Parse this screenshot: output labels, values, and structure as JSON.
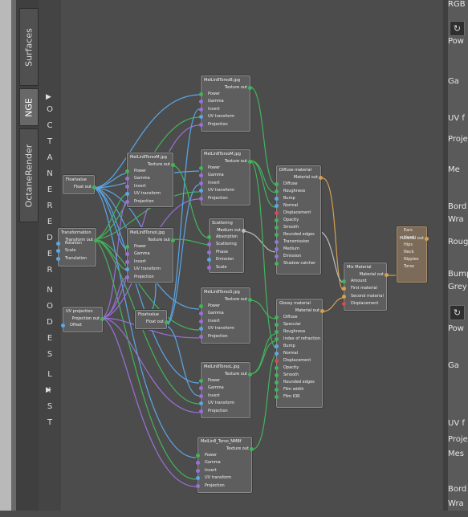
{
  "tabs": [
    {
      "label": "Surfaces",
      "active": false
    },
    {
      "label": "NGE",
      "active": true
    },
    {
      "label": "OctaneRender",
      "active": false
    }
  ],
  "octane_panel": {
    "letters": [
      "O",
      "C",
      "T",
      "A",
      "N",
      "E",
      "R",
      "E",
      "D",
      "E",
      "R",
      "N",
      "O",
      "D",
      "E",
      "S",
      "L",
      "I",
      "S",
      "T"
    ],
    "arrow_top": "▶",
    "arrow_bottom": "▶"
  },
  "nodes": {
    "floatvalue1": {
      "title": "Floatvalue",
      "output": "Float out"
    },
    "transform": {
      "title": "Transformation",
      "output": "Transform out",
      "inputs": [
        "Rotation",
        "Scale",
        "Translation"
      ]
    },
    "uvproj": {
      "title": "UV projection",
      "output": "Projection out",
      "inputs": [
        "Offset"
      ]
    },
    "torso_b": {
      "title": "MelLin8TorsoB.jpg",
      "output": "Texture out",
      "inputs": [
        "Power",
        "Gamma",
        "Invert",
        "UV transform",
        "Projection"
      ]
    },
    "torso_mid": {
      "title": "MelLin8TorsoM.jpg",
      "output": "Texture out",
      "inputs": [
        "Power",
        "Gamma",
        "Invert",
        "UV transform",
        "Projection"
      ]
    },
    "torso_m2": {
      "title": "MelLin8TorsoM.jpg",
      "output": "Texture out",
      "inputs": [
        "Power",
        "Gamma",
        "Invert",
        "UV transform",
        "Projection"
      ]
    },
    "torso_i": {
      "title": "MelLin8TorsoI.jpg",
      "output": "Texture out",
      "inputs": [
        "Power",
        "Gamma",
        "Invert",
        "UV transform",
        "Projection"
      ]
    },
    "scattering": {
      "title": "Scattering",
      "output": "Medium out",
      "inputs": [
        "Absorption",
        "Scattering",
        "Phase",
        "Emission",
        "Scale"
      ]
    },
    "floatvalue2": {
      "title": "Floatvalue",
      "output": "Float out"
    },
    "torso_s": {
      "title": "MelLin8TorsoS.jpg",
      "output": "Texture out",
      "inputs": [
        "Power",
        "Gamma",
        "Invert",
        "UV transform",
        "Projection"
      ]
    },
    "torso_l": {
      "title": "MelLin8TorsoL.jpg",
      "output": "Texture out",
      "inputs": [
        "Power",
        "Gamma",
        "Invert",
        "UV transform",
        "Projection"
      ]
    },
    "torso_nmb": {
      "title": "MelLin8_Torso_NMBf",
      "output": "Texture out",
      "inputs": [
        "Power",
        "Gamma",
        "Invert",
        "UV transform",
        "Projection"
      ]
    },
    "diffuse": {
      "title": "Diffuse material",
      "output": "Material out",
      "inputs": [
        "Diffuse",
        "Roughness",
        "Bump",
        "Normal",
        "Displacement",
        "Opacity",
        "Smooth",
        "Rounded edges",
        "Transmission",
        "Medium",
        "Emission",
        "Shadow catcher"
      ]
    },
    "glossy": {
      "title": "Glossy material",
      "output": "Material out",
      "inputs": [
        "Diffuse",
        "Specular",
        "Roughness",
        "Index of refraction",
        "Bump",
        "Normal",
        "Displacement",
        "Opacity",
        "Smooth",
        "Rounded edges",
        "Film width",
        "Film IOR"
      ]
    },
    "mix": {
      "title": "Mix Material",
      "output": "Material out",
      "inputs": [
        "Amount",
        "First material",
        "Second material",
        "Displacement"
      ]
    },
    "output_node": {
      "inputs": [
        "Ears",
        "Head",
        "Hips",
        "Neck",
        "Nipples",
        "Torso"
      ],
      "output": "Material out"
    }
  },
  "right_panel": {
    "items": [
      "RGB",
      "Pow",
      "Ga",
      "UV f",
      "Proje",
      "Me",
      "Bord",
      "Wra",
      "Rougl",
      "Bump",
      "Grey",
      "Pow",
      "Ga",
      "UV f",
      "Proje",
      "Mes",
      "Bord",
      "Wra"
    ]
  },
  "colors": {
    "wire_blue": "#5aa7e8",
    "wire_green": "#43b45a",
    "wire_purple": "#9a70d8",
    "wire_orange": "#d6a050",
    "wire_gray": "#bdbdbd",
    "pin_red": "#d94a4a"
  }
}
